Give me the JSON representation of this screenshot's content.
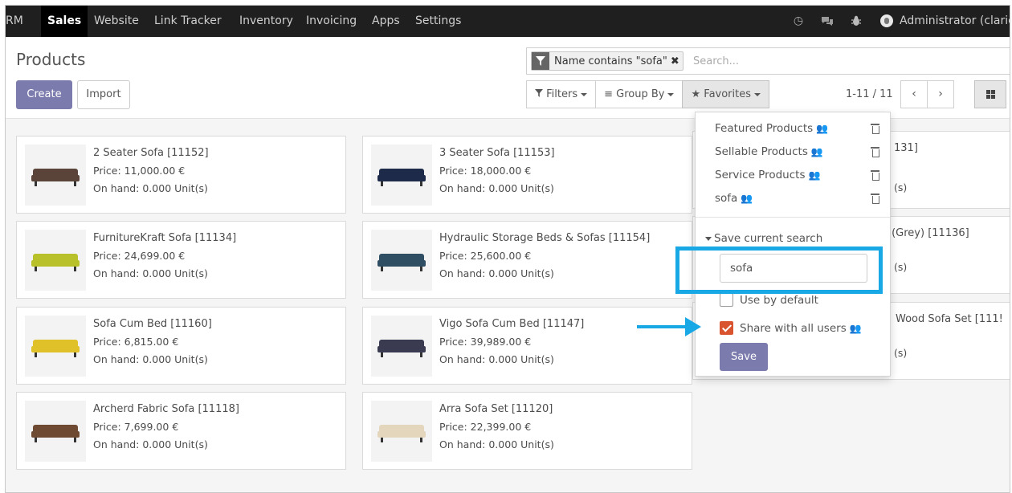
{
  "navbar": {
    "items": [
      "RM",
      "Sales",
      "Website",
      "Link Tracker",
      "Inventory",
      "Invoicing",
      "Apps",
      "Settings"
    ],
    "active": "Sales",
    "user": "Administrator (claric"
  },
  "control_panel": {
    "title": "Products",
    "create_label": "Create",
    "import_label": "Import",
    "search": {
      "facet_label": "Name contains \"sofa\"",
      "facet_remove": "✖",
      "placeholder": "Search..."
    },
    "filters_label": "Filters",
    "group_by_label": "Group By",
    "favorites_label": "Favorites",
    "pager": "1-11 / 11",
    "pager_prev": "‹",
    "pager_next": "›"
  },
  "products": [
    {
      "name": "2 Seater Sofa [11152]",
      "price": "Price: 11,000.00 €",
      "onhand": "On hand: 0.000 Unit(s)",
      "color": "#5a4339"
    },
    {
      "name": "3 Seater Sofa [11153]",
      "price": "Price: 18,000.00 €",
      "onhand": "On hand: 0.000 Unit(s)",
      "color": "#1d2a4a"
    },
    {
      "name": "FurnitureKraft Sofa [11134]",
      "price": "Price: 24,699.00 €",
      "onhand": "On hand: 0.000 Unit(s)",
      "color": "#b9c12a"
    },
    {
      "name": "Hydraulic Storage Beds & Sofas [11154]",
      "price": "Price: 25,600.00 €",
      "onhand": "On hand: 0.000 Unit(s)",
      "color": "#2f4d63"
    },
    {
      "name": "Sofa Cum Bed [11160]",
      "price": "Price: 6,815.00 €",
      "onhand": "On hand: 0.000 Unit(s)",
      "color": "#e0c12a"
    },
    {
      "name": "Vigo Sofa Cum Bed [11147]",
      "price": "Price: 39,989.00 €",
      "onhand": "On hand: 0.000 Unit(s)",
      "color": "#3a3a50"
    },
    {
      "name": "Archerd Fabric Sofa [11118]",
      "price": "Price: 7,699.00 €",
      "onhand": "On hand: 0.000 Unit(s)",
      "color": "#6e4a32"
    },
    {
      "name": "Arra Sofa Set [11120]",
      "price": "Price: 22,399.00 €",
      "onhand": "On hand: 0.000 Unit(s)",
      "color": "#e4d6bc"
    }
  ],
  "partial_cards": [
    {
      "name": "131]",
      "onhand": "(s)"
    },
    {
      "name": "a (Grey) [11136]",
      "onhand": "(s)"
    },
    {
      "name": "Wood Sofa Set [111!",
      "onhand": "(s)"
    }
  ],
  "favorites": {
    "items": [
      "Featured Products",
      "Sellable Products",
      "Service Products",
      "sofa"
    ],
    "save_current_search_label": "Save current search",
    "name_value": "sofa",
    "use_by_default_label": "Use by default",
    "use_by_default_checked": false,
    "share_label": "Share with all users",
    "share_checked": true,
    "save_label": "Save"
  },
  "colors": {
    "navbar": "#1f1f1f",
    "primary": "#7c7bad",
    "annotation": "#19a8e6",
    "checkbox_checked": "#d9542e"
  }
}
